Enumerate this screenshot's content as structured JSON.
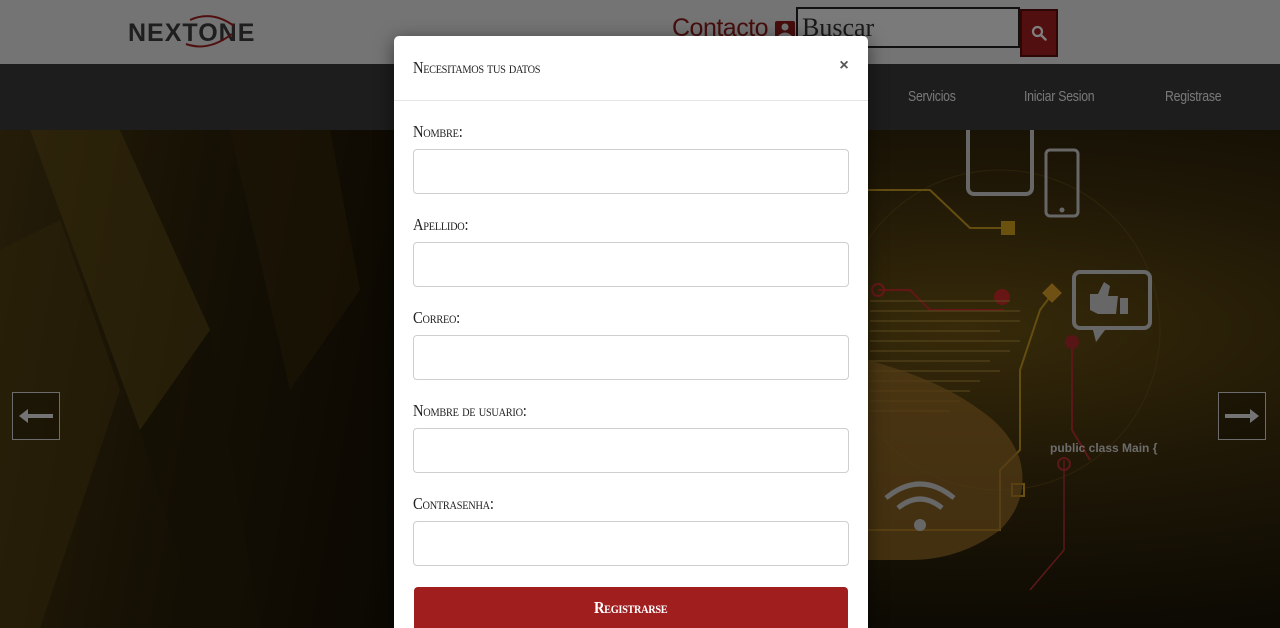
{
  "brand": {
    "logo_text": "NEXTONE",
    "accent_color": "#a01e1e"
  },
  "header": {
    "contacto_label": "Contacto",
    "contacto_icon": "contact-card-icon",
    "search": {
      "value": "Buscar",
      "button_icon": "search-icon"
    }
  },
  "nav": {
    "items": [
      {
        "label": "Servicios"
      },
      {
        "label": "Iniciar Sesion"
      },
      {
        "label": "Registrase"
      }
    ]
  },
  "hero": {
    "code_text": "public class Main {",
    "prev_icon": "arrow-left-icon",
    "next_icon": "arrow-right-icon"
  },
  "modal": {
    "title": "Necesitamos tus datos",
    "close_symbol": "×",
    "fields": [
      {
        "label": "Nombre:",
        "value": ""
      },
      {
        "label": "Apellido:",
        "value": ""
      },
      {
        "label": "Correo:",
        "value": ""
      },
      {
        "label": "Nombre de usuario:",
        "value": ""
      },
      {
        "label": "Contrasenha:",
        "value": ""
      }
    ],
    "submit_label": "Registrarse"
  }
}
